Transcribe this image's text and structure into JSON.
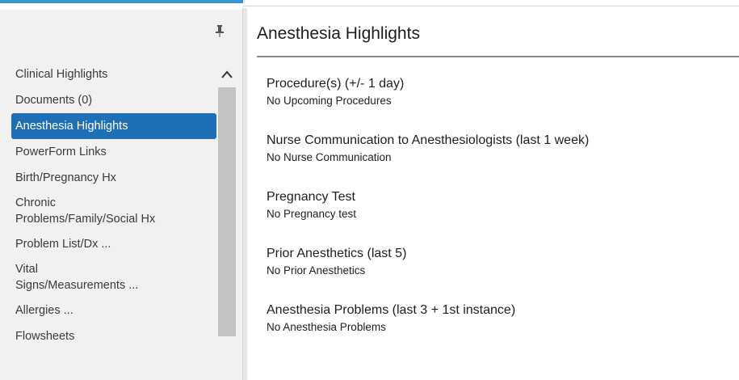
{
  "sidebar": {
    "items": [
      {
        "label": "Clinical Highlights",
        "active": false
      },
      {
        "label": "Documents (0)",
        "active": false
      },
      {
        "label": "Anesthesia Highlights",
        "active": true
      },
      {
        "label": "PowerForm Links",
        "active": false
      },
      {
        "label": "Birth/Pregnancy Hx",
        "active": false
      },
      {
        "label": "Chronic\nProblems/Family/Social Hx",
        "active": false
      },
      {
        "label": "Problem List/Dx ...",
        "active": false
      },
      {
        "label": "Vital\nSigns/Measurements ...",
        "active": false
      },
      {
        "label": "Allergies ...",
        "active": false
      },
      {
        "label": "Flowsheets",
        "active": false
      }
    ]
  },
  "main": {
    "title": "Anesthesia Highlights",
    "sections": [
      {
        "title": "Procedure(s) (+/- 1 day)",
        "value": "No Upcoming Procedures"
      },
      {
        "title": "Nurse Communication to Anesthesiologists (last 1 week)",
        "value": "No Nurse Communication"
      },
      {
        "title": "Pregnancy Test",
        "value": "No Pregnancy test"
      },
      {
        "title": "Prior Anesthetics (last 5)",
        "value": "No Prior Anesthetics"
      },
      {
        "title": "Anesthesia Problems (last 3 + 1st instance)",
        "value": "No Anesthesia Problems"
      }
    ]
  },
  "colors": {
    "accent": "#3d92d0",
    "active_item_bg": "#1f6fb5",
    "sidebar_bg": "#f1f1f1"
  }
}
